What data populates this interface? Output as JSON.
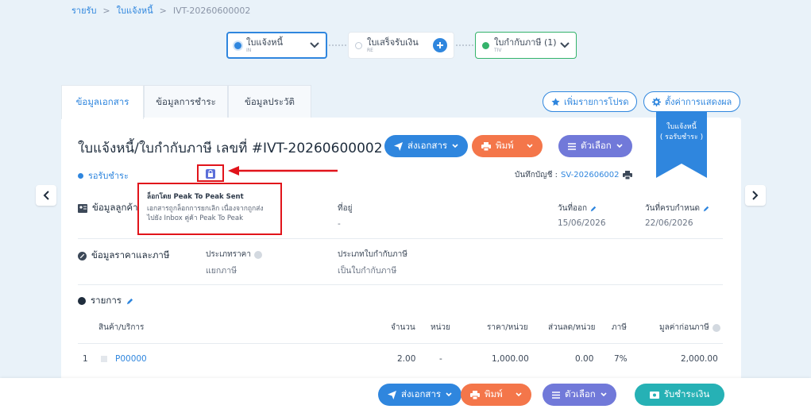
{
  "breadcrumb": {
    "root": "รายรับ",
    "section": "ใบแจ้งหนี้",
    "current": "IVT-20260600002",
    "sep": ">"
  },
  "flow": {
    "step1": {
      "label": "ใบแจ้งหนี้",
      "sub": "IN"
    },
    "step2": {
      "label": "ใบเสร็จรับเงิน",
      "sub": "RE"
    },
    "step3": {
      "label": "ใบกำกับภาษี (1)",
      "sub": "TIV"
    }
  },
  "tabs": [
    "ข้อมูลเอกสาร",
    "ข้อมูลการชำระ",
    "ข้อมูลประวัติ"
  ],
  "top_buttons": {
    "favorite": "เพิ่มรายการโปรด",
    "display_settings": "ตั้งค่าการแสดงผล"
  },
  "ribbon": {
    "line1": "ใบแจ้งหนี้",
    "line2": "( รอรับชำระ )"
  },
  "document": {
    "title": "ใบแจ้งหนี้/ใบกำกับภาษี เลขที่ #IVT-20260600002",
    "status": "รอรับชำระ",
    "account_label": "บันทึกบัญชี :",
    "account_value": "SV-202606002"
  },
  "actions": {
    "send": "ส่งเอกสาร",
    "print": "พิมพ์",
    "options": "ตัวเลือก",
    "receive": "รับชำระเงิน"
  },
  "tooltip": {
    "title": "ล็อกโดย Peak To Peak Sent",
    "line1": "เอกสารถูกล็อกการยกเลิก เนื่องจากถูกส่ง",
    "line2": "ไปยัง Inbox คู่ค้า Peak To Peak"
  },
  "customer": {
    "heading": "ข้อมูลลูกค้า",
    "address_label": "ที่อยู่",
    "address_value": "-",
    "issue_label": "วันที่ออก",
    "issue_value": "15/06/2026",
    "due_label": "วันที่ครบกำหนด",
    "due_value": "22/06/2026"
  },
  "pricing": {
    "heading": "ข้อมูลราคาและภาษี",
    "price_type_label": "ประเภทราคา",
    "price_type_value": "แยกภาษี",
    "tax_type_label": "ประเภทใบกำกับภาษี",
    "tax_type_value": "เป็นใบกำกับภาษี"
  },
  "items": {
    "heading": "รายการ",
    "columns": [
      "สินค้า/บริการ",
      "จำนวน",
      "หน่วย",
      "ราคา/หน่วย",
      "ส่วนลด/หน่วย",
      "ภาษี",
      "มูลค่าก่อนภาษี"
    ],
    "rows": [
      {
        "no": "1",
        "product": "P00000",
        "qty": "2.00",
        "unit": "-",
        "price": "1,000.00",
        "discount": "0.00",
        "tax": "7%",
        "amount": "2,000.00"
      }
    ]
  },
  "colors": {
    "primary": "#2f86de",
    "orange": "#f4764a",
    "purple": "#7179d9",
    "teal": "#26b1b5",
    "highlight": "#e1141b",
    "green": "#34b36b"
  }
}
